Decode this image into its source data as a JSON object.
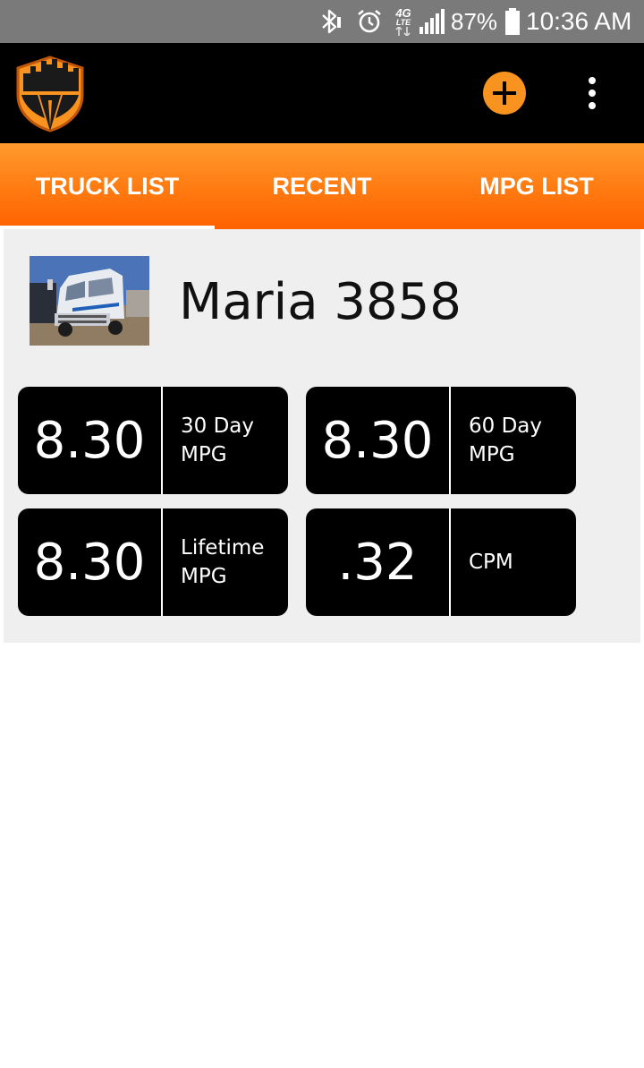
{
  "status_bar": {
    "bluetooth_icon": "bluetooth-icon",
    "alarm_icon": "alarm-icon",
    "network_top": "4G",
    "network_bottom": "LTE",
    "battery_percent": "87%",
    "time": "10:36 AM"
  },
  "app_bar": {
    "logo_icon": "city-shield-logo",
    "add_icon": "plus-icon",
    "menu_icon": "more-vert-icon",
    "accent_color": "#f7931e"
  },
  "tabs": [
    {
      "label": "TRUCK LIST",
      "active": true
    },
    {
      "label": "RECENT",
      "active": false
    },
    {
      "label": "MPG LIST",
      "active": false
    }
  ],
  "truck": {
    "name": "Maria 3858",
    "stats": [
      {
        "value": "8.30",
        "label_line1": "30 Day",
        "label_line2": "MPG"
      },
      {
        "value": "8.30",
        "label_line1": "60 Day",
        "label_line2": "MPG"
      },
      {
        "value": "8.30",
        "label_line1": "Lifetime",
        "label_line2": "MPG"
      },
      {
        "value": ".32",
        "label_line1": "CPM",
        "label_line2": ""
      }
    ]
  },
  "colors": {
    "tab_gradient_top": "#ff9a2e",
    "tab_gradient_bottom": "#ff6200",
    "card_background": "#efefef",
    "tile_background": "#000000"
  }
}
